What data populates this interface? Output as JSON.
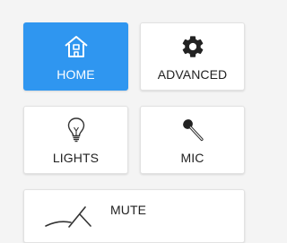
{
  "tiles": {
    "home": {
      "label": "HOME",
      "icon": "home-icon",
      "active": true
    },
    "advanced": {
      "label": "ADVANCED",
      "icon": "gear-icon",
      "active": false
    },
    "lights": {
      "label": "LIGHTS",
      "icon": "lightbulb-icon",
      "active": false
    },
    "mic": {
      "label": "MIC",
      "icon": "microphone-icon",
      "active": false
    },
    "mute": {
      "label": "MUTE",
      "icon": "mute-icon",
      "active": false
    }
  },
  "colors": {
    "accent": "#2f96f0",
    "tile_bg": "#ffffff",
    "page_bg": "#f4f4f4",
    "text": "#222222"
  }
}
